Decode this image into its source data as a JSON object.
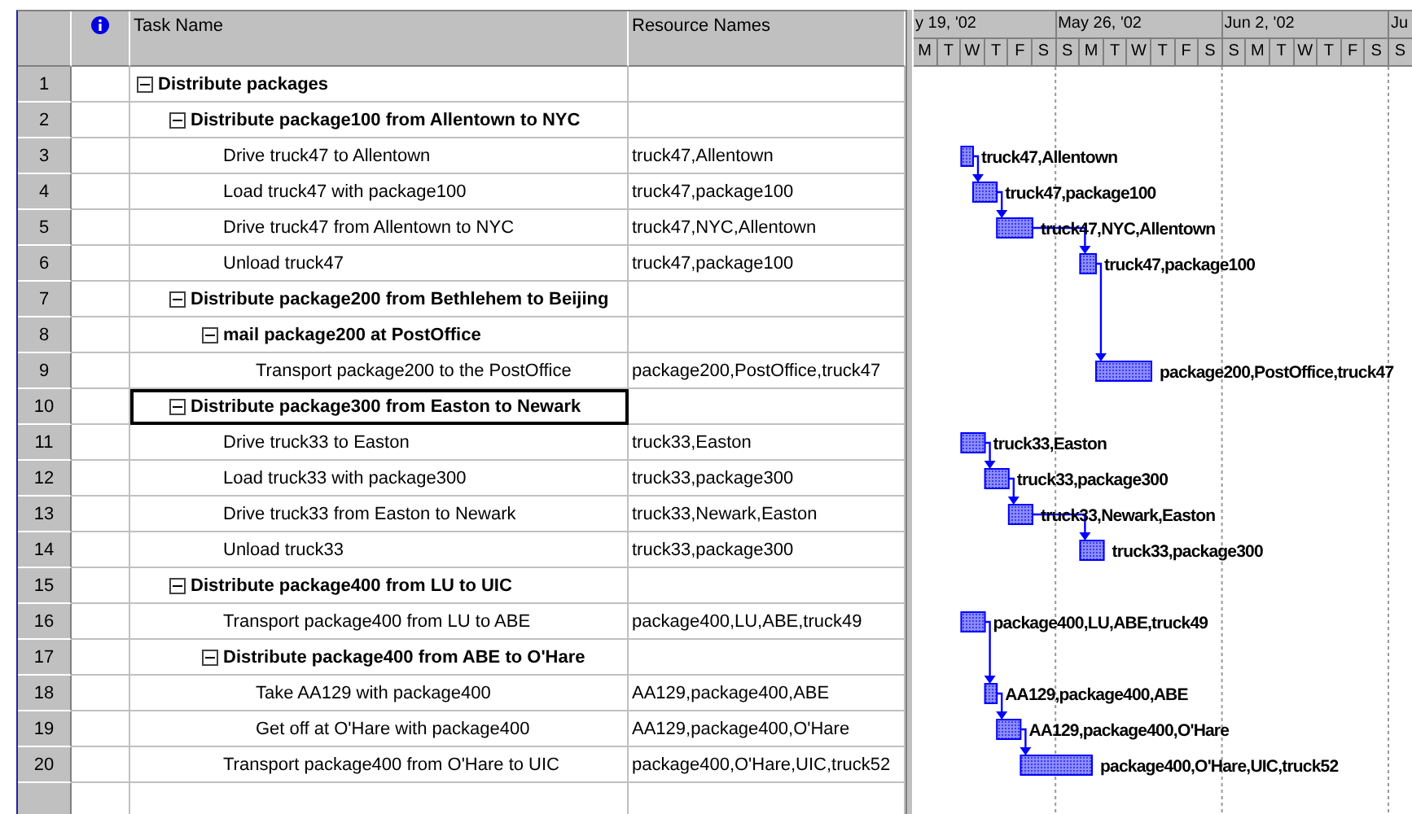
{
  "table": {
    "columns": [
      "Task Name",
      "Resource Names"
    ]
  },
  "timescale": {
    "weeks": [
      {
        "label": "y 19, '02",
        "days": [
          "M",
          "T",
          "W",
          "T",
          "F",
          "S"
        ]
      },
      {
        "label": "May 26, '02",
        "days": [
          "S",
          "M",
          "T",
          "W",
          "T",
          "F",
          "S"
        ]
      },
      {
        "label": "Jun 2, '02",
        "days": [
          "S",
          "M",
          "T",
          "W",
          "T",
          "F",
          "S"
        ]
      },
      {
        "label": "Ju",
        "days": [
          "S"
        ]
      }
    ]
  },
  "tasks": [
    {
      "id": "1",
      "name": "Distribute packages",
      "kind": "summary",
      "expanded": true,
      "selected": false,
      "children": [
        {
          "id": "2",
          "name": "Distribute package100 from Allentown to NYC",
          "kind": "summary",
          "expanded": true,
          "selected": false,
          "children": [
            {
              "id": "3",
              "name": "Drive truck47 to Allentown",
              "kind": "task",
              "resources": "truck47,Allentown",
              "selected": false,
              "bar": {
                "label": "truck47,Allentown",
                "linked": true
              }
            },
            {
              "id": "4",
              "name": "Load truck47 with package100",
              "kind": "task",
              "resources": "truck47,package100",
              "selected": false,
              "bar": {
                "label": "truck47,package100",
                "linked": true
              }
            },
            {
              "id": "5",
              "name": "Drive truck47 from Allentown to NYC",
              "kind": "task",
              "resources": "truck47,NYC,Allentown",
              "selected": false,
              "bar": {
                "label": "truck47,NYC,Allentown",
                "linked": true
              }
            },
            {
              "id": "6",
              "name": "Unload truck47",
              "kind": "task",
              "resources": "truck47,package100",
              "selected": false,
              "bar": {
                "label": "truck47,package100",
                "linked": true
              }
            }
          ]
        },
        {
          "id": "7",
          "name": "Distribute package200 from Bethlehem to Beijing",
          "kind": "summary",
          "expanded": true,
          "selected": false,
          "children": [
            {
              "id": "8",
              "name": "mail package200 at PostOffice",
              "kind": "summary",
              "expanded": true,
              "selected": false,
              "children": [
                {
                  "id": "9",
                  "name": "Transport package200 to the PostOffice",
                  "kind": "task",
                  "resources": "package200,PostOffice,truck47",
                  "selected": false,
                  "bar": {
                    "label": "package200,PostOffice,truck47",
                    "linked": false
                  }
                }
              ]
            }
          ]
        },
        {
          "id": "10",
          "name": "Distribute package300 from Easton to Newark",
          "kind": "summary",
          "expanded": true,
          "selected": true,
          "children": [
            {
              "id": "11",
              "name": "Drive truck33 to Easton",
              "kind": "task",
              "resources": "truck33,Easton",
              "selected": false,
              "bar": {
                "label": "truck33,Easton",
                "linked": true
              }
            },
            {
              "id": "12",
              "name": "Load truck33 with package300",
              "kind": "task",
              "resources": "truck33,package300",
              "selected": false,
              "bar": {
                "label": "truck33,package300",
                "linked": true
              }
            },
            {
              "id": "13",
              "name": "Drive truck33 from Easton to Newark",
              "kind": "task",
              "resources": "truck33,Newark,Easton",
              "selected": false,
              "bar": {
                "label": "truck33,Newark,Easton",
                "linked": true
              }
            },
            {
              "id": "14",
              "name": "Unload truck33",
              "kind": "task",
              "resources": "truck33,package300",
              "selected": false,
              "bar": {
                "label": "truck33,package300",
                "linked": false
              }
            }
          ]
        },
        {
          "id": "15",
          "name": "Distribute package400 from LU to UIC",
          "kind": "summary",
          "expanded": true,
          "selected": false,
          "children": [
            {
              "id": "16",
              "name": "Transport package400 from LU to ABE",
              "kind": "task",
              "resources": "package400,LU,ABE,truck49",
              "selected": false,
              "bar": {
                "label": "package400,LU,ABE,truck49",
                "linked": true
              }
            },
            {
              "id": "17",
              "name": "Distribute package400 from ABE to O'Hare",
              "kind": "summary",
              "expanded": true,
              "selected": false,
              "children": [
                {
                  "id": "18",
                  "name": "Take AA129 with package400",
                  "kind": "task",
                  "resources": "AA129,package400,ABE",
                  "selected": false,
                  "bar": {
                    "label": "AA129,package400,ABE",
                    "linked": true
                  }
                },
                {
                  "id": "19",
                  "name": "Get off at O'Hare with package400",
                  "kind": "task",
                  "resources": "AA129,package400,O'Hare",
                  "selected": false,
                  "bar": {
                    "label": "AA129,package400,O'Hare",
                    "linked": true
                  }
                }
              ]
            },
            {
              "id": "20",
              "name": "Transport package400 from O'Hare to UIC",
              "kind": "task",
              "resources": "package400,O'Hare,UIC,truck52",
              "selected": false,
              "bar": {
                "label": "package400,O'Hare,UIC,truck52",
                "linked": false
              }
            }
          ]
        }
      ]
    }
  ]
}
